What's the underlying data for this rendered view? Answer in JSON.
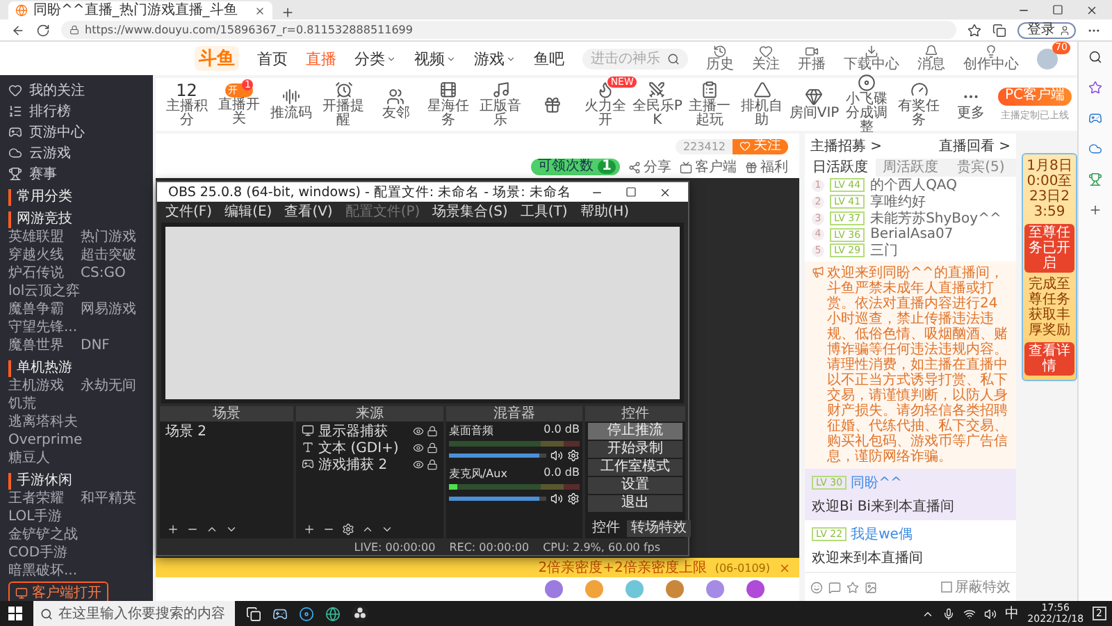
{
  "browser": {
    "tab_title": "同盼^^直播_热门游戏直播_斗鱼",
    "url": "https://www.douyu.com/15896367_r=0.811532888511699",
    "login": "登录"
  },
  "site": {
    "logo": "斗鱼",
    "nav": [
      {
        "label": "首页",
        "selected": false,
        "dropdown": false
      },
      {
        "label": "直播",
        "selected": true,
        "dropdown": false
      },
      {
        "label": "分类",
        "selected": false,
        "dropdown": true
      },
      {
        "label": "视频",
        "selected": false,
        "dropdown": true
      },
      {
        "label": "游戏",
        "selected": false,
        "dropdown": true
      },
      {
        "label": "鱼吧",
        "selected": false,
        "dropdown": false
      }
    ],
    "search_placeholder": "进击の神乐",
    "actions": [
      {
        "kind": "history",
        "label": "历史"
      },
      {
        "kind": "follow",
        "label": "关注"
      },
      {
        "kind": "live",
        "label": "开播"
      },
      {
        "kind": "download",
        "label": "下载中心"
      },
      {
        "kind": "message",
        "label": "消息"
      },
      {
        "kind": "creator",
        "label": "创作中心"
      }
    ],
    "avatar_badge": "70"
  },
  "sidebar": {
    "items": [
      {
        "kind": "follow",
        "label": "我的关注"
      },
      {
        "kind": "rank",
        "label": "排行榜"
      },
      {
        "kind": "webgame",
        "label": "页游中心"
      },
      {
        "kind": "cloud",
        "label": "云游戏"
      },
      {
        "kind": "event",
        "label": "赛事"
      }
    ],
    "sections": [
      {
        "title": "常用分类"
      },
      {
        "title": "网游竞技",
        "items": [
          "英雄联盟",
          "热门游戏",
          "穿越火线",
          "超击突破",
          "炉石传说",
          "CS:GO",
          "lol云顶之弈",
          "魔兽争霸",
          "网易游戏",
          "守望先锋...",
          "魔兽世界",
          "DNF"
        ]
      },
      {
        "title": "单机热游",
        "items": [
          "主机游戏",
          "永劫无间",
          "饥荒",
          "逃离塔科夫",
          "Overprime",
          "糖豆人"
        ]
      },
      {
        "title": "手游休闲",
        "items": [
          "王者荣耀",
          "和平精英",
          "LOL手游",
          "金铲铲之战",
          "COD手游",
          "暗黑破坏..."
        ]
      }
    ],
    "button": "客户端打开"
  },
  "toolbar": {
    "score": "12",
    "score_label": "主播积分",
    "items": [
      {
        "kind": "toggle",
        "label": "直播开关",
        "badge": "1",
        "state_text": "开",
        "on": true
      },
      {
        "kind": "audio",
        "label": "推流码"
      },
      {
        "kind": "alarm",
        "label": "开播提醒"
      },
      {
        "kind": "users",
        "label": "友邻"
      },
      {
        "kind": "ad",
        "label": "星海任务"
      },
      {
        "kind": "music",
        "label": "正版音乐"
      },
      {
        "kind": "gift"
      },
      {
        "kind": "flame",
        "label": "火力全开",
        "badge": "NEW"
      },
      {
        "kind": "pk",
        "label": "全民乐PK"
      },
      {
        "kind": "list",
        "label": "主播一起玩"
      },
      {
        "kind": "cone",
        "label": "排机自助"
      },
      {
        "kind": "vip",
        "label": "房间VIP"
      },
      {
        "kind": "ufo",
        "label": "小飞碟分成调整"
      },
      {
        "kind": "gauge",
        "label": "有奖任务"
      },
      {
        "kind": "more",
        "label": "更多"
      }
    ],
    "pc_button": "PC客户端",
    "pc_note": "主播定制已上线"
  },
  "room": {
    "viewers": "223412",
    "follow": "关注",
    "claim_label": "可领次数",
    "claim_count": "1",
    "actions": [
      {
        "kind": "share",
        "label": "分享"
      },
      {
        "kind": "client",
        "label": "客户端"
      },
      {
        "kind": "welfare",
        "label": "福利"
      }
    ]
  },
  "banner": {
    "text": "2倍亲密度+2倍亲密度上限",
    "period": "(06-0109)"
  },
  "chat": {
    "links": [
      "主播招募 >",
      "直播回看 >"
    ],
    "tabs": [
      {
        "label": "日活跃度",
        "selected": true
      },
      {
        "label": "周活跃度",
        "selected": false
      },
      {
        "label": "贵宾(5)",
        "selected": false
      }
    ],
    "ranks": [
      {
        "rank": "1",
        "level": "LV 44",
        "name": "的个西人QAQ"
      },
      {
        "rank": "2",
        "level": "LV 41",
        "name": "享唯约好"
      },
      {
        "rank": "3",
        "level": "LV 37",
        "name": "未能芳苏ShyBoy^^"
      },
      {
        "rank": "4",
        "level": "LV 36",
        "name": "BerialAsa07"
      },
      {
        "rank": "5",
        "level": "LV 29",
        "name": "三门"
      }
    ],
    "notice": "欢迎来到同盼^^的直播间，斗鱼严禁未成年人直播或打赏。依法对直播内容进行24小时巡查，禁止传播违法违规、低俗色情、吸烟酗酒、赌博诈骗等任何违法违规内容。请理性消费，如主播在直播中以不正当方式诱导打赏、私下交易，请谨慎判断，以防人身财产损失。请勿轻信各类招聘征婚、代练代抽、私下交易、购买礼包码、游戏币等广告信息，谨防网络诈骗。",
    "messages": [
      {
        "level": "LV 30",
        "user": "同盼^^",
        "text": "欢迎Bi Bi来到本直播间",
        "highlighted": true
      },
      {
        "level": "LV 22",
        "user": "我是we偶",
        "text": "欢迎来到本直播间",
        "highlighted": false
      }
    ],
    "mute_effects": {
      "label": "屏蔽特效",
      "checked": false
    }
  },
  "promo": {
    "dates": "1月8日0:00至23日23:59",
    "status": "至尊任务已开启",
    "desc": "完成至尊任务获取丰厚奖励",
    "link": "查看详情"
  },
  "obs": {
    "title": "OBS 25.0.8 (64-bit, windows) - 配置文件: 未命名 - 场景: 未命名",
    "menu": [
      {
        "label": "文件(F)",
        "disabled": false
      },
      {
        "label": "编辑(E)",
        "disabled": false
      },
      {
        "label": "查看(V)",
        "disabled": false
      },
      {
        "label": "配置文件(P)",
        "disabled": true
      },
      {
        "label": "场景集合(S)",
        "disabled": false
      },
      {
        "label": "工具(T)",
        "disabled": false
      },
      {
        "label": "帮助(H)",
        "disabled": false
      }
    ],
    "docks": {
      "scenes": "场景",
      "sources": "来源",
      "mixer": "混音器",
      "controls": "控件"
    },
    "scenes": [
      {
        "name": "场景 2",
        "selected": false
      }
    ],
    "sources": [
      {
        "kind": "monitor",
        "name": "显示器捕获"
      },
      {
        "kind": "text",
        "name": "文本 (GDI+)"
      },
      {
        "kind": "game",
        "name": "游戏捕获 2"
      }
    ],
    "mixer": [
      {
        "name": "桌面音频",
        "reading": "0.0 dB",
        "level": 0.93,
        "meter": {
          "level": 0
        }
      },
      {
        "name": "麦克风/Aux",
        "reading": "0.0 dB",
        "level": 0.93,
        "meter": {
          "level": 0.06
        }
      }
    ],
    "controls": [
      {
        "label": "停止推流",
        "active": true
      },
      {
        "label": "开始录制",
        "active": false
      },
      {
        "label": "工作室模式",
        "active": false
      },
      {
        "label": "设置",
        "active": false
      },
      {
        "label": "退出",
        "active": false
      }
    ],
    "control_tabs": [
      {
        "label": "控件",
        "selected": true
      },
      {
        "label": "转场特效",
        "selected": false
      }
    ],
    "status": {
      "live": "LIVE: 00:00:00",
      "rec": "REC: 00:00:00",
      "cpu": "CPU: 2.9%, 60.00 fps"
    }
  },
  "taskbar": {
    "search_placeholder": "在这里输入你要搜索的内容",
    "ime": "中",
    "time": "17:56",
    "date": "2022/12/18",
    "notifications": "2"
  }
}
